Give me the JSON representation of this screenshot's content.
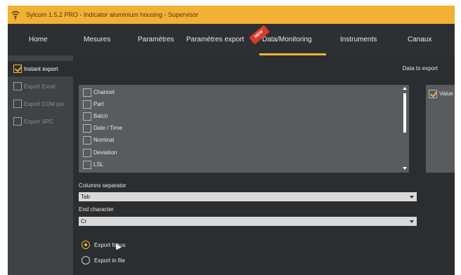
{
  "window": {
    "title": "Sylcom 1.5.2 PRO - Indicator aluminium housing - Supervisor",
    "app_icon": "wifi-signal-icon"
  },
  "menu": {
    "items": [
      {
        "label": "Home"
      },
      {
        "label": "Mesures"
      },
      {
        "label": "Paramètres"
      },
      {
        "label": "Paramètres export"
      },
      {
        "label": "Data/Monitoring"
      },
      {
        "label": "Instruments"
      },
      {
        "label": "Canaux"
      }
    ],
    "active": "Data/Monitoring",
    "new_badge": "NEW"
  },
  "sidebar": {
    "items": [
      {
        "label": "Instant export",
        "checked": true
      },
      {
        "label": "Export Excel",
        "checked": false
      },
      {
        "label": "Export COM por",
        "checked": false
      },
      {
        "label": "Export SPC",
        "checked": false
      }
    ]
  },
  "main": {
    "data_to_export_label": "Data to export",
    "fields": [
      {
        "label": "Channel",
        "checked": false
      },
      {
        "label": "Part",
        "checked": false
      },
      {
        "label": "Batch",
        "checked": false
      },
      {
        "label": "Date / Time",
        "checked": false
      },
      {
        "label": "Nominal",
        "checked": false
      },
      {
        "label": "Deviation",
        "checked": false
      },
      {
        "label": "LSL",
        "checked": false
      }
    ],
    "selected_field": {
      "label": "Value",
      "checked": true
    },
    "columns_separator": {
      "label": "Columns separator",
      "value": "Tab"
    },
    "end_character": {
      "label": "End character",
      "value": "Cr"
    },
    "export_mode": {
      "options": [
        {
          "label": "Export focus",
          "selected": true
        },
        {
          "label": "Export in file",
          "selected": false
        }
      ]
    }
  },
  "colors": {
    "accent": "#f2b134",
    "menubar": "#2d3033",
    "panel": "#585c5f",
    "background": "#2b2e31"
  }
}
